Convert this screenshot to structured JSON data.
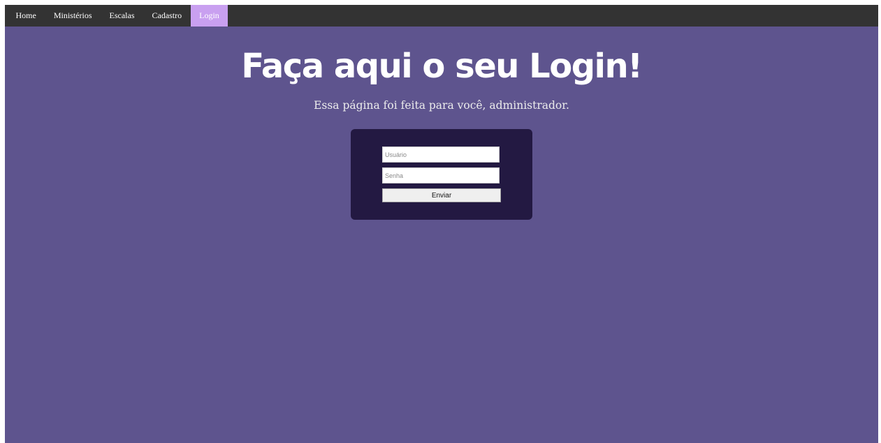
{
  "nav": {
    "items": [
      {
        "label": "Home"
      },
      {
        "label": "Ministérios"
      },
      {
        "label": "Escalas"
      },
      {
        "label": "Cadastro"
      },
      {
        "label": "Login",
        "active": true
      }
    ]
  },
  "hero": {
    "title": "Faça aqui o seu Login!",
    "subtitle": "Essa página foi feita para você, administrador."
  },
  "login_form": {
    "username": {
      "value": "",
      "placeholder": "Usuário"
    },
    "password": {
      "value": "",
      "placeholder": "Senha"
    },
    "submit_label": "Enviar"
  },
  "colors": {
    "page_background": "#5e548e",
    "navbar_background": "#333333",
    "nav_active": "#c9a0f0",
    "card_background": "#231942"
  }
}
